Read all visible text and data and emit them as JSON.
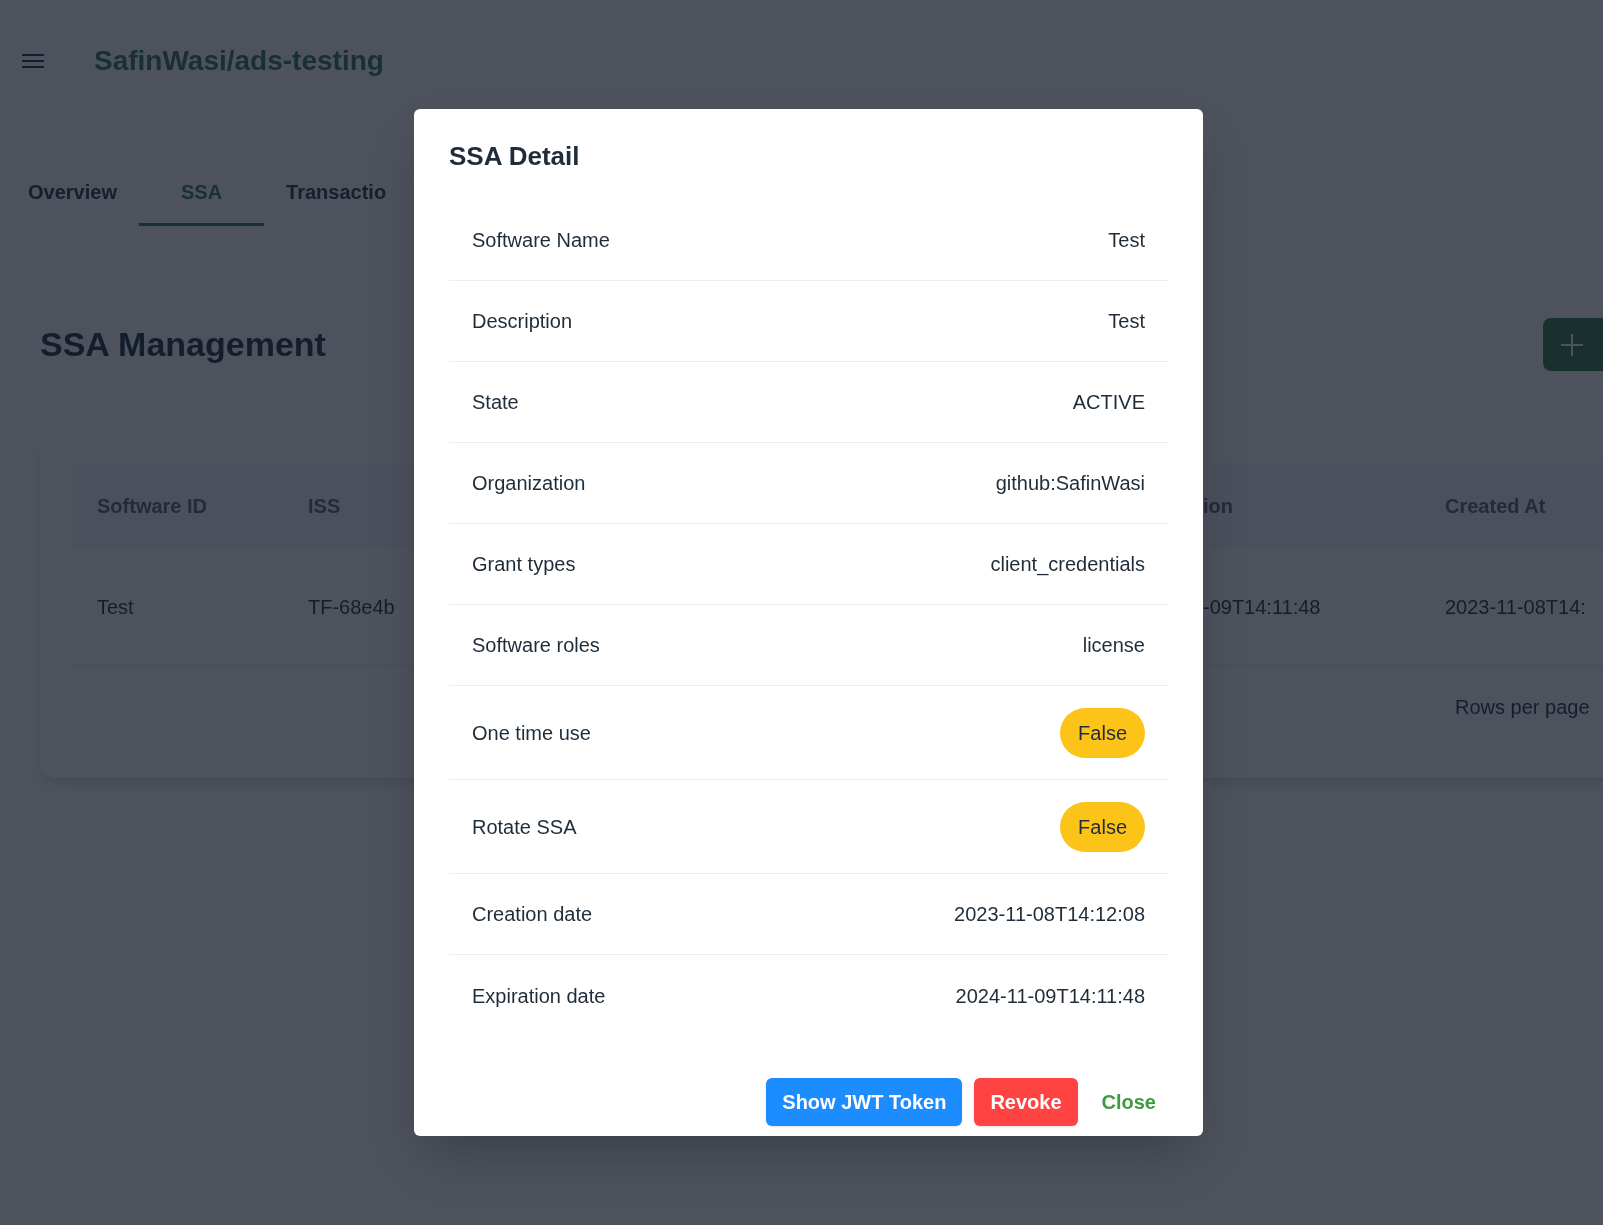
{
  "header": {
    "title": "SafinWasi/ads-testing"
  },
  "tabs": [
    {
      "label": "Overview",
      "selected": false
    },
    {
      "label": "SSA",
      "selected": true
    },
    {
      "label": "Transactio",
      "selected": false
    }
  ],
  "page": {
    "heading": "SSA Management"
  },
  "table": {
    "columns": [
      "Software ID",
      "ISS",
      "ion",
      "Created At"
    ],
    "rows": [
      [
        "Test",
        "TF-68e4b",
        "-09T14:11:48",
        "2023-11-08T14:"
      ]
    ],
    "footer": "Rows per page"
  },
  "dialog": {
    "title": "SSA Detail",
    "fields": [
      {
        "label": "Software Name",
        "value": "Test",
        "kind": "text"
      },
      {
        "label": "Description",
        "value": "Test",
        "kind": "text"
      },
      {
        "label": "State",
        "value": "ACTIVE",
        "kind": "text"
      },
      {
        "label": "Organization",
        "value": "github:SafinWasi",
        "kind": "text"
      },
      {
        "label": "Grant types",
        "value": "client_credentials",
        "kind": "text"
      },
      {
        "label": "Software roles",
        "value": "license",
        "kind": "text"
      },
      {
        "label": "One time use",
        "value": "False",
        "kind": "badge"
      },
      {
        "label": "Rotate SSA",
        "value": "False",
        "kind": "badge"
      },
      {
        "label": "Creation date",
        "value": "2023-11-08T14:12:08",
        "kind": "text"
      },
      {
        "label": "Expiration date",
        "value": "2024-11-09T14:11:48",
        "kind": "text"
      }
    ],
    "buttons": [
      {
        "label": "Show JWT Token",
        "kind": "primary"
      },
      {
        "label": "Revoke",
        "kind": "danger"
      },
      {
        "label": "Close",
        "kind": "text"
      }
    ]
  }
}
